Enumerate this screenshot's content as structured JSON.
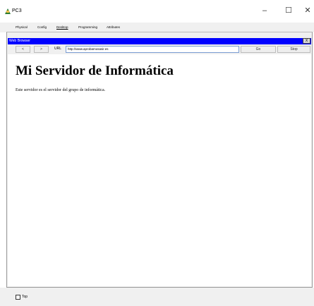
{
  "window": {
    "title": "PC3",
    "minimize_glyph": "–",
    "maximize_glyph": "☐",
    "close_glyph": "✕"
  },
  "tabs": [
    "Physical",
    "Config",
    "Desktop",
    "Programming",
    "Attributes"
  ],
  "active_tab": "Desktop",
  "web_browser": {
    "title": "Web Browser",
    "close_label": "X",
    "back_label": "<",
    "forward_label": ">",
    "url_label": "URL",
    "url_value": "http://www.aprobamosasir.es",
    "go_label": "Go",
    "stop_label": "Stop"
  },
  "page": {
    "heading": "Mi Servidor de Informática",
    "paragraph": "Este servidor es el servidor del grupo de informática."
  },
  "footer": {
    "top_label": "Top",
    "top_checked": false
  },
  "colors": {
    "browser_header": "#0000ff",
    "app_icon": "#2e7d32"
  },
  "icons": {
    "app": "pc-app-icon"
  }
}
